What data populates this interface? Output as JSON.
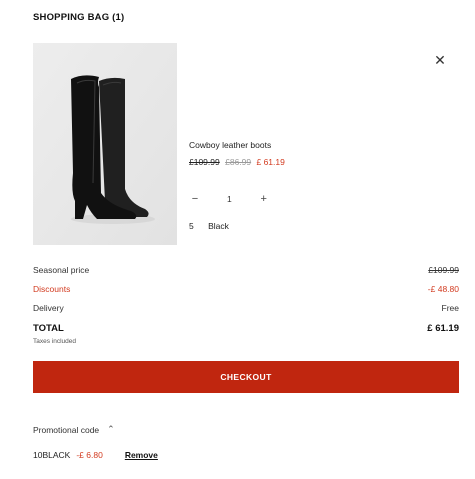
{
  "bag": {
    "title": "SHOPPING BAG (1)"
  },
  "item": {
    "name": "Cowboy leather boots",
    "price_original": "£109.99",
    "price_previous": "£86.99",
    "price_final": "£ 61.19",
    "quantity": "1",
    "size": "5",
    "color": "Black",
    "remove_icon": "close-icon"
  },
  "summary": {
    "seasonal_label": "Seasonal price",
    "seasonal_value": "£109.99",
    "discounts_label": "Discounts",
    "discounts_value": "-£ 48.80",
    "delivery_label": "Delivery",
    "delivery_value": "Free",
    "total_label": "TOTAL",
    "total_value": "£ 61.19",
    "taxes_note": "Taxes included"
  },
  "checkout": {
    "label": "CHECKOUT"
  },
  "promo": {
    "label": "Promotional code",
    "code": "10BLACK",
    "discount": "-£ 6.80",
    "remove_label": "Remove"
  },
  "colors": {
    "accent_red": "#c0260f",
    "discount_red": "#d23a1f"
  }
}
